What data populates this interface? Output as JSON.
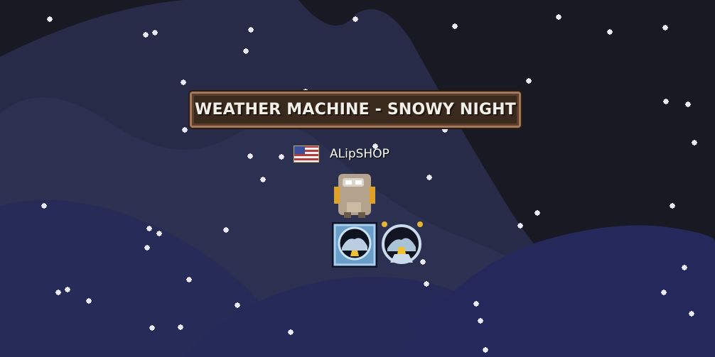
{
  "world": {
    "sign_text": "WEATHER MACHINE - SNOWY NIGHT",
    "background": "snowy-night",
    "colors": {
      "sky": "#191923",
      "mountain": "#2b2f4e",
      "sign_border": "#a4785b",
      "snowflake": "#e8e8f2"
    }
  },
  "player": {
    "name": "ALipSHOP",
    "flag_icon": "usa-flag-icon",
    "avatar_icon": "growtopian-avatar-icon"
  },
  "items": [
    {
      "name": "weather-machine-snowy-icon"
    },
    {
      "name": "snow-globe-icon"
    }
  ]
}
